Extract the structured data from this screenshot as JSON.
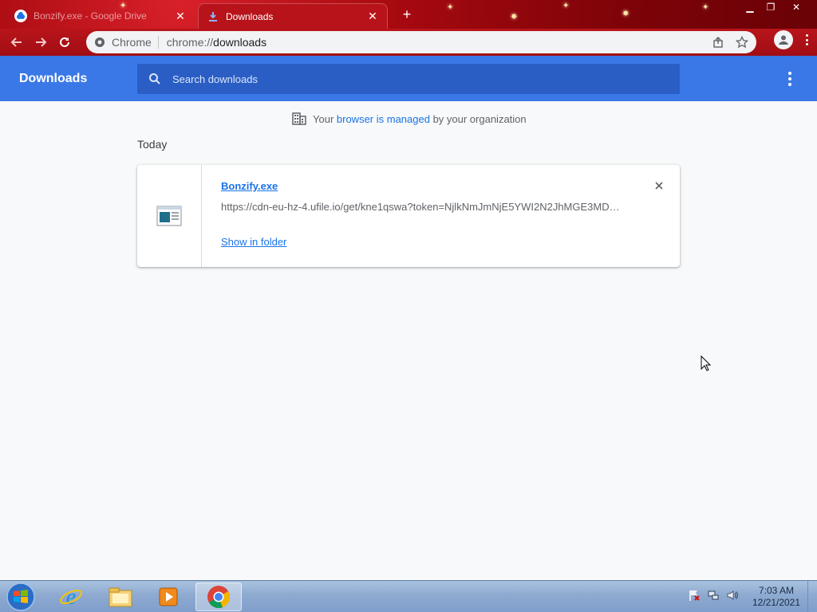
{
  "browser": {
    "tabs": [
      {
        "title": "Bonzify.exe - Google Drive",
        "favicon": "drive-icon",
        "active": false
      },
      {
        "title": "Downloads",
        "favicon": "download-icon",
        "active": true
      }
    ],
    "omnibox": {
      "chip": "Chrome",
      "url_scheme": "chrome://",
      "url_path": "downloads"
    }
  },
  "page": {
    "title": "Downloads",
    "search_placeholder": "Search downloads",
    "managed_prefix": "Your ",
    "managed_link": "browser is managed",
    "managed_suffix": " by your organization",
    "section": "Today",
    "download": {
      "filename": "Bonzify.exe",
      "url": "https://cdn-eu-hz-4.ufile.io/get/kne1qswa?token=NjlkNmJmNjE5YWI2N2JhMGE3MD…",
      "action": "Show in folder"
    }
  },
  "taskbar": {
    "time": "7:03 AM",
    "date": "12/21/2021"
  },
  "colors": {
    "header_blue": "#3b78e7",
    "link_blue": "#1a73e8",
    "titlebar_red": "#a5090f"
  }
}
